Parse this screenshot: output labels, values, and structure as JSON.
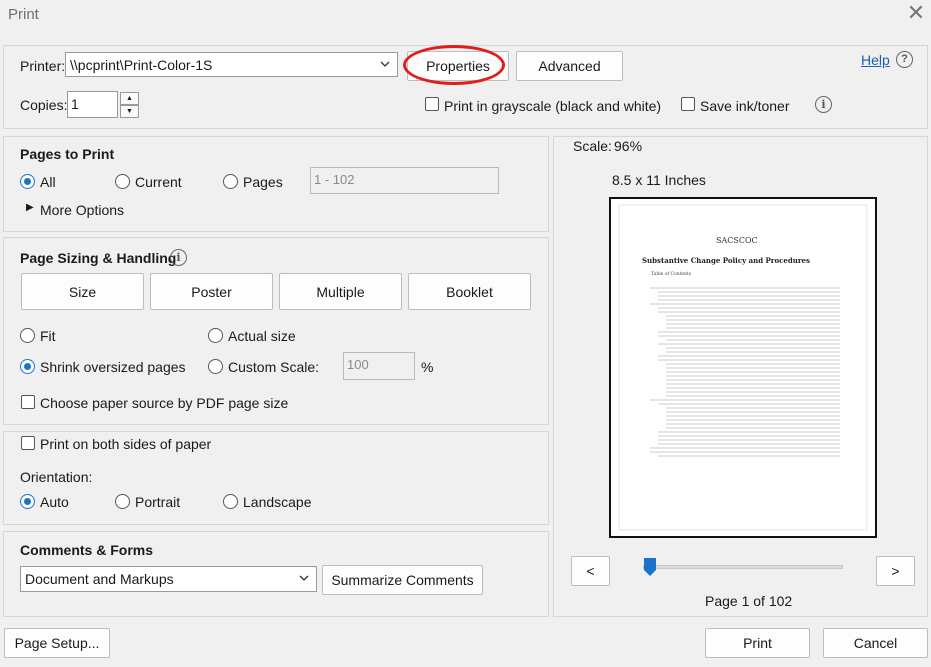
{
  "window": {
    "title": "Print"
  },
  "header": {
    "printer_label": "Printer:",
    "printer_value": "\\\\pcprint\\Print-Color-1S",
    "properties_label": "Properties",
    "advanced_label": "Advanced",
    "help_label": "Help",
    "copies_label": "Copies:",
    "copies_value": "1",
    "grayscale_label": "Print in grayscale (black and white)",
    "save_ink_label": "Save ink/toner"
  },
  "pages_to_print": {
    "heading": "Pages to Print",
    "all_label": "All",
    "current_label": "Current",
    "pages_label": "Pages",
    "pages_range": "1 - 102",
    "more_options_label": "More Options",
    "selected": "all"
  },
  "page_sizing": {
    "heading": "Page Sizing & Handling",
    "tabs": [
      "Size",
      "Poster",
      "Multiple",
      "Booklet"
    ],
    "fit_label": "Fit",
    "actual_size_label": "Actual size",
    "shrink_label": "Shrink oversized pages",
    "custom_scale_label": "Custom Scale:",
    "custom_scale_value": "100",
    "percent_label": "%",
    "paper_source_label": "Choose paper source by PDF page size",
    "selected": "shrink"
  },
  "orientation": {
    "both_sides_label": "Print on both sides of paper",
    "heading": "Orientation:",
    "auto_label": "Auto",
    "portrait_label": "Portrait",
    "landscape_label": "Landscape",
    "selected": "auto"
  },
  "comments": {
    "heading": "Comments & Forms",
    "value": "Document and Markups",
    "summarize_label": "Summarize Comments"
  },
  "preview": {
    "scale_label": "Scale:",
    "scale_value": "96%",
    "paper_size": "8.5 x 11 Inches",
    "prev_label": "<",
    "next_label": ">",
    "page_indicator": "Page 1 of 102",
    "doc_logo": "SACSCOC",
    "doc_title": "Substantive Change Policy and Procedures",
    "doc_toc": "Table of Contents"
  },
  "footer": {
    "page_setup_label": "Page Setup...",
    "print_label": "Print",
    "cancel_label": "Cancel"
  },
  "colors": {
    "accent": "#1a73c8",
    "highlight_ring": "#e31b1b",
    "help_link": "#1a5fb4"
  }
}
